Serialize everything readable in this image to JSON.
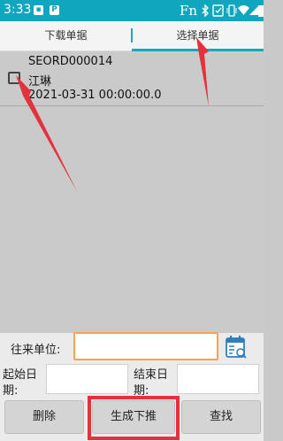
{
  "status_bar": {
    "time": "3:33",
    "notif_icons": [
      "app-notification-icon",
      "p-notification-icon"
    ],
    "fn_label": "Fn",
    "right_icons": [
      "bluetooth-icon",
      "rotation-lock-icon",
      "vibrate-icon",
      "wifi-icon",
      "signal-icon",
      "battery-icon"
    ]
  },
  "tabs": [
    {
      "label": "下载单据",
      "selected": false
    },
    {
      "label": "选择单据",
      "selected": true
    }
  ],
  "records": [
    {
      "checked": false,
      "code": "SEORD000014",
      "name": "江琳",
      "datetime": "2021-03-31 00:00:00.0"
    }
  ],
  "form": {
    "partner_label": "往来单位:",
    "partner_value": "",
    "start_label_line1": "起始日",
    "start_label_line2": "期:",
    "start_value": "",
    "end_label_line1": "结束日",
    "end_label_line2": "期:",
    "end_value": ""
  },
  "buttons": {
    "delete": "删除",
    "generate": "生成下推",
    "search": "查找"
  },
  "colors": {
    "accent": "#10a6bd",
    "focus_border": "#f5a251",
    "annotation": "#e4323c"
  }
}
